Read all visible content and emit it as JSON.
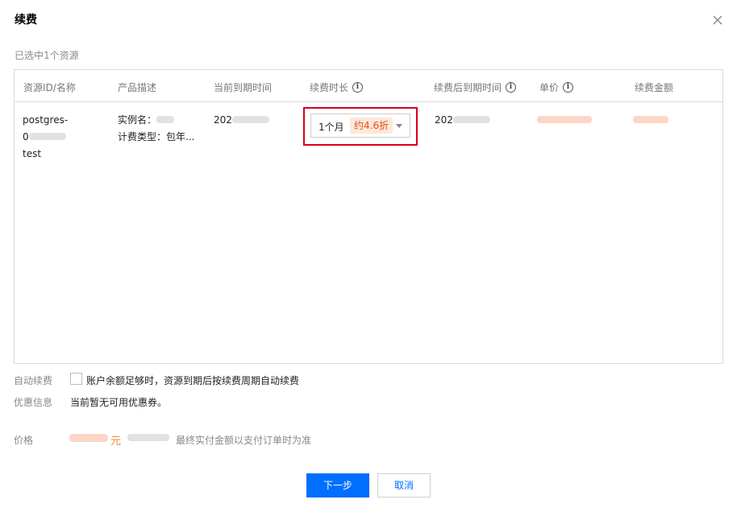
{
  "dialog": {
    "title": "续费"
  },
  "selection": {
    "summary": "已选中1个资源"
  },
  "table": {
    "headers": {
      "resource": "资源ID/名称",
      "product": "产品描述",
      "current_expiry": "当前到期时间",
      "duration": "续费时长",
      "new_expiry": "续费后到期时间",
      "unit_price": "单价",
      "amount": "续费金额"
    },
    "row": {
      "resource_line1": "postgres-",
      "resource_line2": "0",
      "resource_line3": "test",
      "product_instance_label": "实例名：",
      "product_billing": "计费类型：包年...",
      "current_expiry_prefix": "202",
      "new_expiry_prefix": "202",
      "duration_value": "1个月",
      "discount_badge": "约4.6折"
    }
  },
  "auto_renew": {
    "label": "自动续费",
    "text": "账户余额足够时，资源到期后按续费周期自动续费"
  },
  "coupon": {
    "label": "优惠信息",
    "text": "当前暂无可用优惠券。"
  },
  "price": {
    "label": "价格",
    "unit": "元",
    "note": "最终实付金额以支付订单时为准"
  },
  "buttons": {
    "next": "下一步",
    "cancel": "取消"
  },
  "icons": {
    "close": "close-icon",
    "info": "info-icon",
    "dropdown": "caret-down-icon"
  },
  "colors": {
    "primary": "#006eff",
    "highlight_border": "#d9001b",
    "discount_text": "#e44d1c",
    "price": "#f08a36"
  }
}
